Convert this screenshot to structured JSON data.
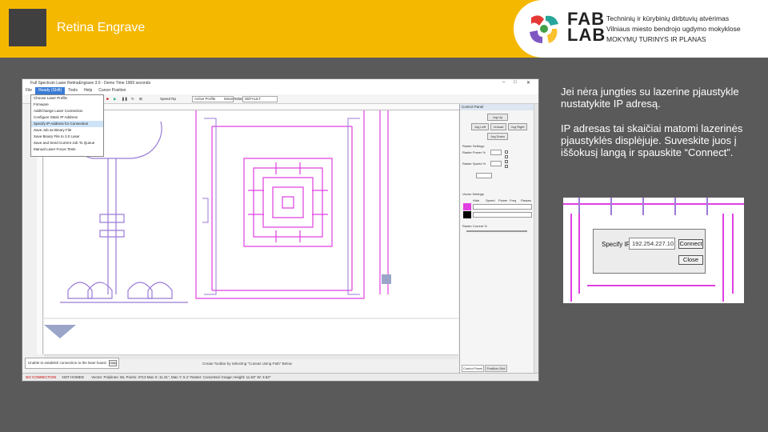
{
  "header": {
    "title": "Retina Engrave",
    "logo_line1": "FAB",
    "logo_line2": "LAB",
    "subtitle_lines": [
      "Techninių ir kūrybinių dirbtuvių atvėrimas",
      "Vilniaus miesto bendrojo ugdymo mokyklose",
      "MOKYMŲ TURINYS IR PLANAS"
    ]
  },
  "app": {
    "title": "Full Spectrum Laser RetinaEngrave 3.0 - Demo Time 1969 seconds",
    "menu": [
      "File",
      "Ready (Shift)",
      "Tools",
      "Help",
      "Cursor Position"
    ],
    "toolbar": {
      "speed_label": "Speed Rp",
      "speed_value": "Active Profile",
      "mode_label": "Move Relative",
      "mode_value": "DEFAULT"
    },
    "dropdown_items": [
      "Choose Laser Profile",
      "Firmware",
      "Add/Change Laser Connection",
      "Configure Static IP Address",
      "Specify IP Address for Connection",
      "Save Job as Binary File",
      "Save Binary File to 3.0 Laser",
      "Save and Send Current Job To Queue",
      "Manual Laser Focus Tests"
    ],
    "notification": "Unable to establish connection to the laser board.",
    "notification_btn": "Hide",
    "bottom_note": "Create Toolbar by Selecting \"Cutouts Using Path\" Below",
    "status": {
      "connection": "NO CONNECTION",
      "homed": "NOT HOMED",
      "info": "Vector: Polylines: 56, Points: 3713 Max X: 11.31\", Max Y: 5.1\" Raster: Converted: Image: Height: 11.63\" W: 3.63\""
    },
    "panel": {
      "title": "Control Panel",
      "jog_up": "Jog Up",
      "jog_left": "Jog Left",
      "jog_home": "Unload",
      "jog_right": "Jog Right",
      "jog_down": "Jog Down",
      "raster_settings": "Raster Settings",
      "raster_power": "Raster Power %",
      "raster_speed": "Raster Speed %",
      "vector_settings": "Vector Settings",
      "vector_list_header": [
        "Hide",
        "Speed",
        "Power",
        "Freq",
        "Passes"
      ],
      "raster_current": "Raster Current %",
      "tabs": [
        "Control Panel",
        "Position Grid"
      ]
    }
  },
  "right_text": {
    "para1": "Jei nėra jungties su lazerine pjaustykle nustatykite IP adresą.",
    "para2": "IP adresas tai skaičiai matomi lazerinės pjaustyklės displėjuje. Suveskite juos į iššokusį langą ir spauskite “Connect”."
  },
  "zoom_dialog": {
    "label": "Specify IP:",
    "value": "192.254.227.10",
    "connect": "Connect",
    "close": "Close"
  },
  "colors": {
    "header_bg": "#f5b800",
    "slide_bg": "#5a5a5a",
    "vector_magenta": "#e040e0",
    "vector_violet": "#9a7ad8"
  }
}
